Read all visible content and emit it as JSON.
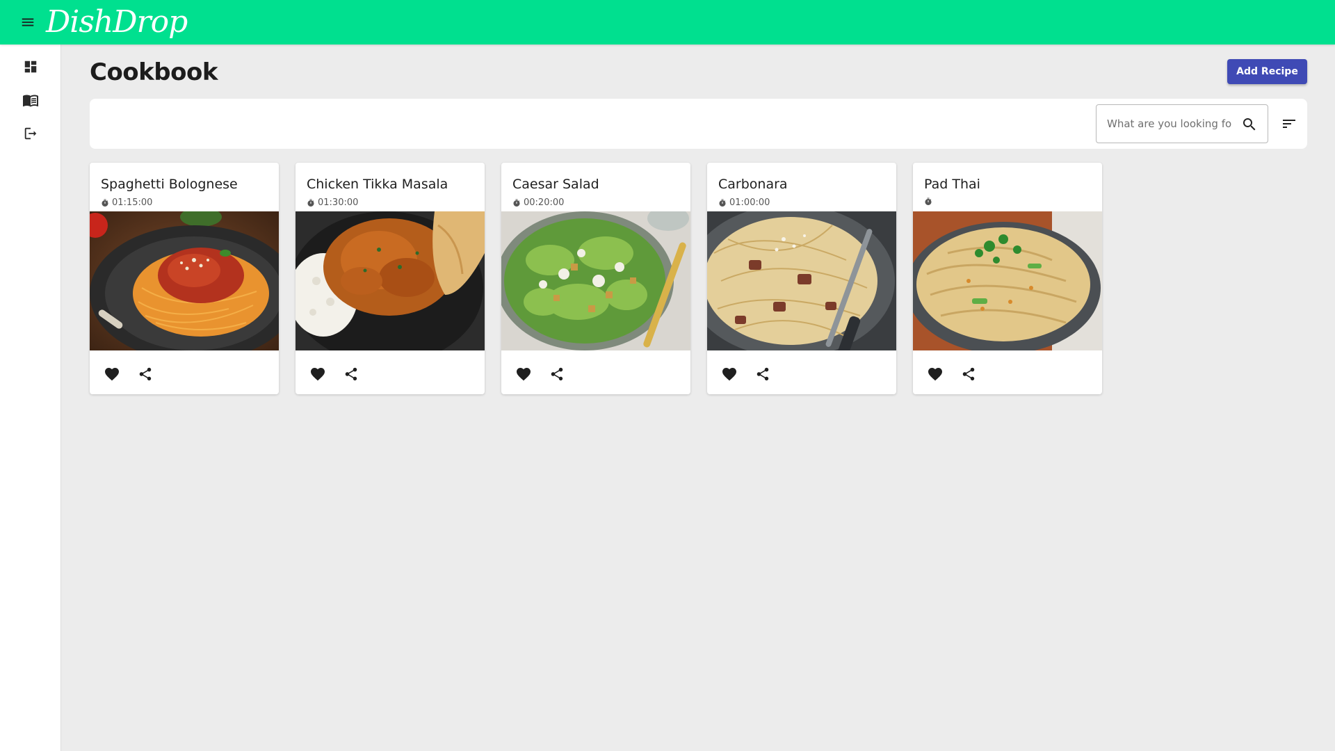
{
  "app": {
    "brand": "DishDrop",
    "colors": {
      "appbar": "#00e08f",
      "primary_button": "#3f4ab5",
      "background": "#ececec"
    }
  },
  "sidebar": {
    "items": [
      {
        "icon": "dashboard-icon"
      },
      {
        "icon": "book-icon"
      },
      {
        "icon": "logout-icon"
      }
    ]
  },
  "page": {
    "title": "Cookbook",
    "add_button_label": "Add Recipe"
  },
  "search": {
    "placeholder": "What are you looking fo",
    "value": ""
  },
  "recipes": [
    {
      "title": "Spaghetti Bolognese",
      "time": "01:15:00",
      "image": "spaghetti-bolognese-photo"
    },
    {
      "title": "Chicken Tikka Masala",
      "time": "01:30:00",
      "image": "chicken-tikka-masala-photo"
    },
    {
      "title": "Caesar Salad",
      "time": "00:20:00",
      "image": "caesar-salad-photo"
    },
    {
      "title": "Carbonara",
      "time": "01:00:00",
      "image": "carbonara-photo"
    },
    {
      "title": "Pad Thai",
      "time": "",
      "image": "pad-thai-photo"
    }
  ]
}
